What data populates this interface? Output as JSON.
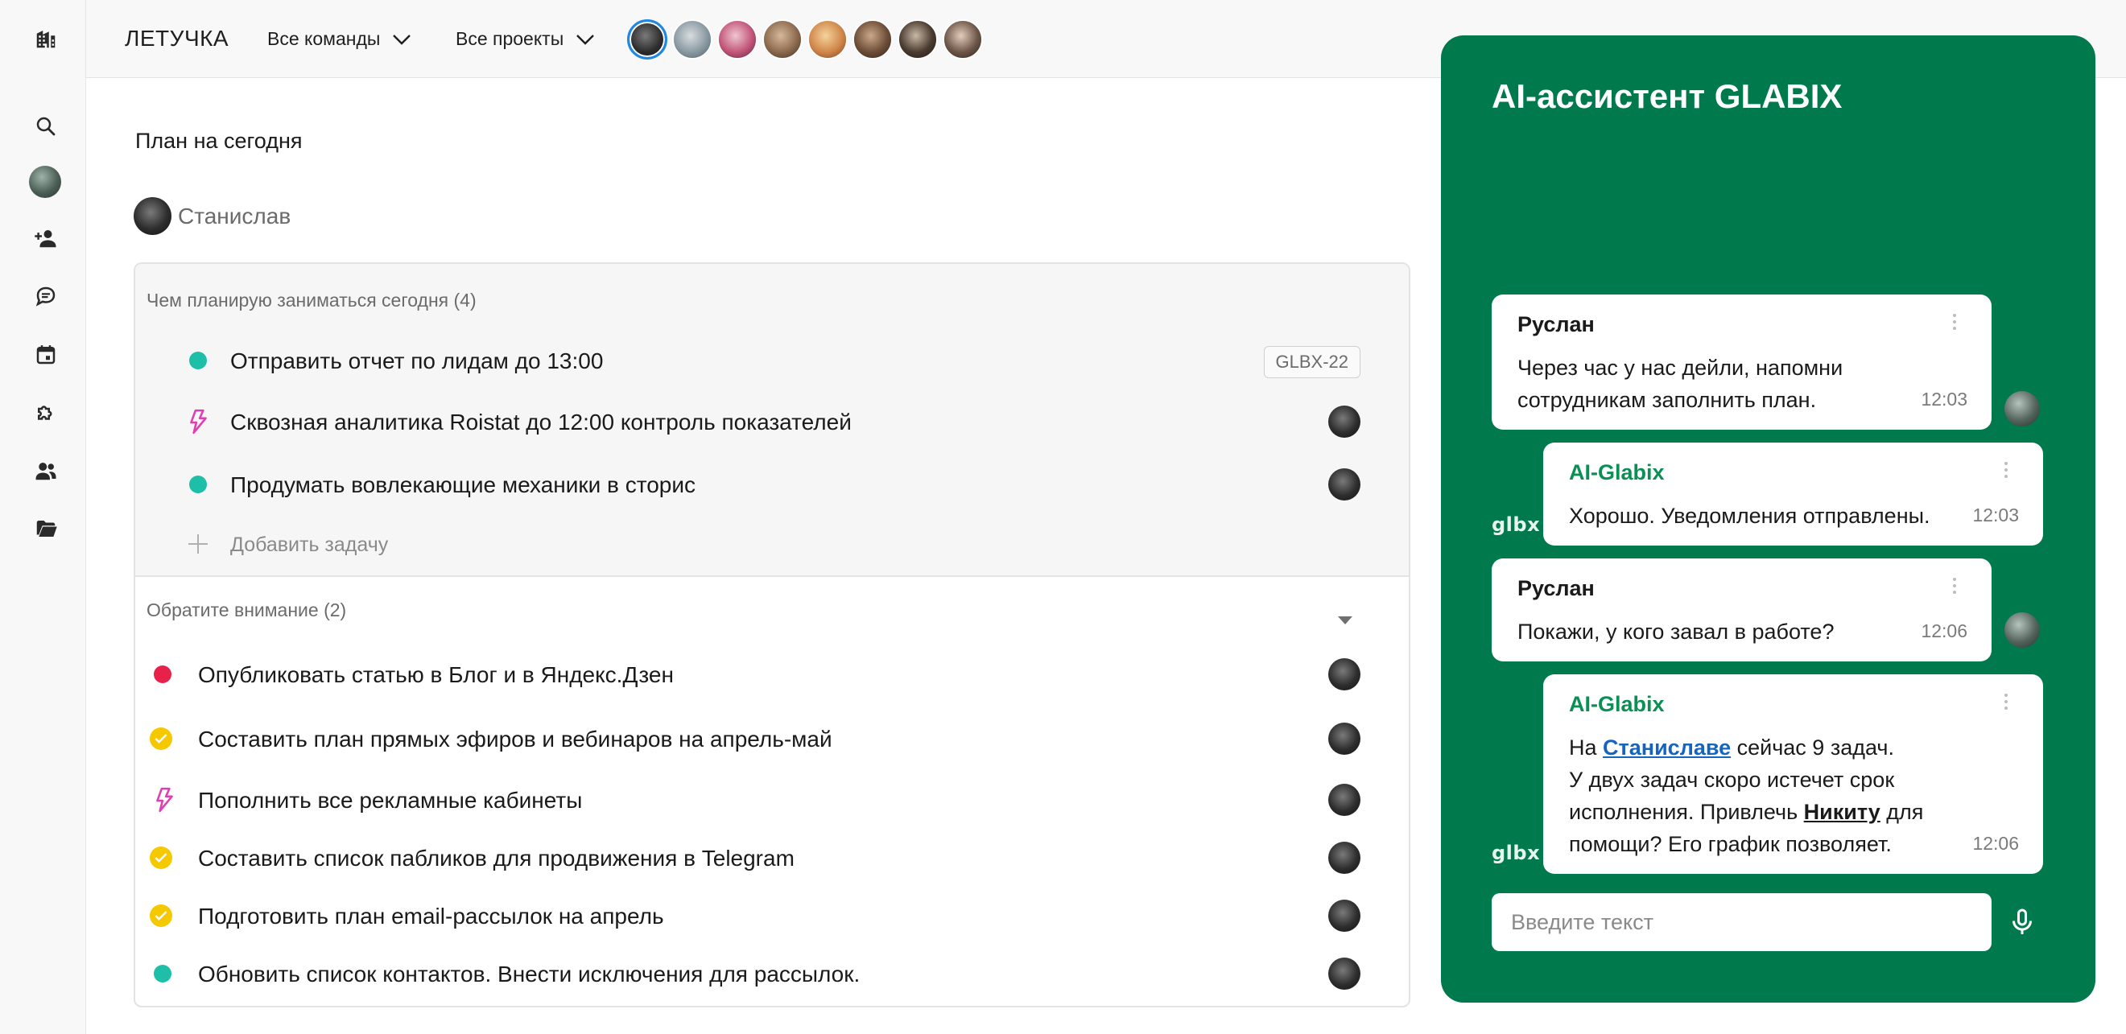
{
  "colors": {
    "accent_green": "#007a4d",
    "dot_teal": "#1dbfa8",
    "dot_red": "#e8214a",
    "check_yellow": "#f5c800",
    "bolt_pink": "#e03eb3",
    "link_blue": "#1565c0"
  },
  "sidebar": {
    "icons": [
      "building-icon",
      "search-icon",
      "avatar",
      "add-user-icon",
      "chat-icon",
      "calendar-icon",
      "puzzle-icon",
      "people-icon",
      "folder-icon"
    ]
  },
  "header": {
    "brand": "ЛЕТУЧКА",
    "teams_dropdown": "Все команды",
    "projects_dropdown": "Все проекты"
  },
  "main": {
    "title": "План на сегодня",
    "person": "Станислав",
    "today_section": {
      "title": "Чем планирую заниматься сегодня (4)",
      "tasks": [
        {
          "text": "Отправить отчет по лидам  до 13:00",
          "marker": "dot-teal",
          "tag": "GLBX-22"
        },
        {
          "text": "Сквозная аналитика Roistat до 12:00 контроль показателей",
          "marker": "bolt"
        },
        {
          "text": "Продумать вовлекающие механики в сторис",
          "marker": "dot-teal"
        }
      ],
      "add_task": "Добавить задачу"
    },
    "attention_section": {
      "title": "Обратите внимание (2)",
      "tasks": [
        {
          "text": "Опубликовать статью  в Блог и в Яндекс.Дзен",
          "marker": "dot-red"
        },
        {
          "text": "Составить план прямых эфиров и вебинаров на апрель-май",
          "marker": "check"
        },
        {
          "text": "Пополнить все рекламные кабинеты",
          "marker": "bolt"
        },
        {
          "text": "Составить список пабликов для продвижения в Telegram",
          "marker": "check"
        },
        {
          "text": "Подготовить план email-рассылок на апрель",
          "marker": "check"
        },
        {
          "text": "Обновить список контактов. Внести исключения для рассылок.",
          "marker": "dot-teal"
        }
      ]
    }
  },
  "assistant": {
    "title": "AI-ассистент GLABIX",
    "bot_logo": "glbx",
    "messages": [
      {
        "author": "Руслан",
        "lines": [
          "Через час у нас дейли, напомни",
          "сотрудникам заполнить план."
        ],
        "time": "12:03"
      },
      {
        "author": "AI-Glabix",
        "lines": [
          "Хорошо. Уведомления отправлены."
        ],
        "time": "12:03"
      },
      {
        "author": "Руслан",
        "lines": [
          "Покажи, у кого завал в работе?"
        ],
        "time": "12:06"
      },
      {
        "author": "AI-Glabix",
        "line1_pre": "На ",
        "line1_link": "Станиславе",
        "line1_post": " сейчас 9 задач.",
        "line2": "У двух задач скоро истечет срок",
        "line3_pre": "исполнения. Привлечь ",
        "line3_link": "Никиту",
        "line3_post": " для",
        "line4": "помощи? Его график позволяет.",
        "time": "12:06"
      }
    ],
    "input_placeholder": "Введите текст"
  }
}
